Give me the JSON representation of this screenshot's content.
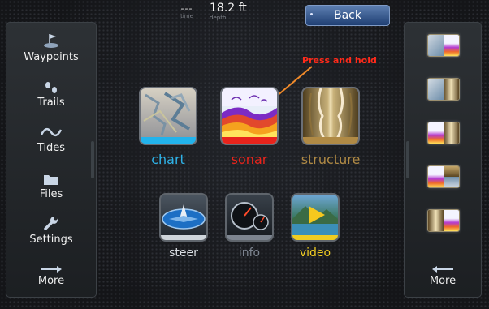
{
  "topbar": {
    "time_value": "---",
    "time_label": "time",
    "depth_value": "18.2 ft",
    "depth_label": "depth",
    "back_label": "Back"
  },
  "left_nav": {
    "items": [
      {
        "label": "Waypoints",
        "icon": "waypoint-icon"
      },
      {
        "label": "Trails",
        "icon": "trails-icon"
      },
      {
        "label": "Tides",
        "icon": "tides-icon"
      },
      {
        "label": "Files",
        "icon": "folder-icon"
      },
      {
        "label": "Settings",
        "icon": "wrench-icon"
      },
      {
        "label": "More",
        "icon": "arrow-right-icon"
      }
    ]
  },
  "apps": {
    "row1": [
      {
        "label": "chart",
        "color": "#2fb3e8"
      },
      {
        "label": "sonar",
        "color": "#e8241c"
      },
      {
        "label": "structure",
        "color": "#b08a45"
      }
    ],
    "row2": [
      {
        "label": "steer",
        "color": "#cfd6dc"
      },
      {
        "label": "info",
        "color": "#7d8590"
      },
      {
        "label": "video",
        "color": "#f0cc22"
      }
    ]
  },
  "annotation": {
    "text": "Press and hold",
    "color": "#ff2a1a"
  },
  "right_panel": {
    "thumbnails": [
      "chart-sonar",
      "chart-structure",
      "sonar-structure",
      "sonar-structure-chart",
      "structure-sonar"
    ],
    "more_label": "More"
  }
}
